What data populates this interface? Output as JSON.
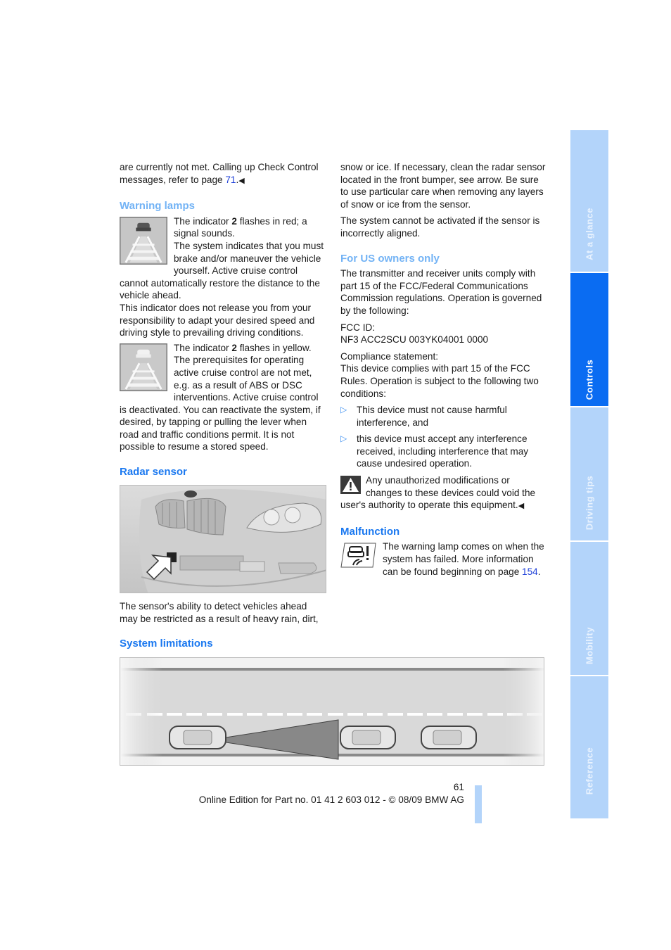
{
  "left_column": {
    "intro": {
      "text_before": "are currently not met. Calling up Check Control messages, refer to page ",
      "link": "71",
      "text_after": ".",
      "end_mark": "◀"
    },
    "warning_lamps": {
      "heading": "Warning lamps",
      "red": {
        "icon": "acc-warning-lamp-red-icon",
        "t1": "The indicator ",
        "bold": "2",
        "t2": " flashes in red; a signal sounds.",
        "body": "The system indicates that you must brake and/or maneuver the vehicle yourself. Active cruise control cannot automatically restore the distance to the vehicle ahead.",
        "note": "This indicator does not release you from your responsibility to adapt your desired speed and driving style to prevailing driving conditions."
      },
      "yellow": {
        "icon": "acc-warning-lamp-yellow-icon",
        "t1": "The indicator ",
        "bold": "2",
        "t2": " flashes in yellow.",
        "body": "The prerequisites for operating active cruise control are not met, e.g. as a result of ABS or DSC interventions. Active cruise control is deactivated. You can reactivate the system, if desired, by tapping or pulling the lever when road and traffic conditions permit. It is not possible to resume a stored speed."
      }
    },
    "radar_sensor": {
      "heading": "Radar sensor",
      "image_alt": "Front bumper with arrow pointing to radar sensor",
      "text": "The sensor's ability to detect vehicles ahead may be restricted as a result of heavy rain, dirt,"
    },
    "system_limitations": {
      "heading": "System limitations",
      "image_alt": "Road diagram with radar beam and vehicles ahead"
    }
  },
  "right_column": {
    "continued": "snow or ice. If necessary, clean the radar sensor located in the front bumper, see arrow. Be sure to use particular care when removing any layers of snow or ice from the sensor.",
    "alignment": "The system cannot be activated if the sensor is incorrectly aligned.",
    "us_owners": {
      "heading": "For US owners only",
      "text": "The transmitter and receiver units comply with part 15 of the FCC/Federal Communications Commission regulations. Operation is governed by the following:",
      "fcc_label": "FCC ID:",
      "fcc_id": "NF3 ACC2SCU 003YK04001 0000",
      "compliance_label": "Compliance statement:",
      "compliance_text": "This device complies with part 15 of the FCC Rules. Operation is subject to the following two conditions:",
      "bullets": [
        "This device must not cause harmful interference, and",
        "this device must accept any interference received, including interference that may cause undesired operation."
      ],
      "bullet_marker": "▷",
      "warning": {
        "icon": "warning-triangle-icon",
        "text": "Any unauthorized modifications or changes to these devices could void the user's authority to operate this equipment.",
        "end_mark": "◀"
      }
    },
    "malfunction": {
      "heading": "Malfunction",
      "icon": "acc-malfunction-lamp-icon",
      "text_before": "The warning lamp comes on when the system has failed. More information can be found beginning on page ",
      "link": "154",
      "text_after": "."
    }
  },
  "side_tabs": [
    {
      "label": "At a glance",
      "active": false
    },
    {
      "label": "Controls",
      "active": true
    },
    {
      "label": "Driving tips",
      "active": false
    },
    {
      "label": "Mobility",
      "active": false
    },
    {
      "label": "Reference",
      "active": false
    }
  ],
  "footer": {
    "page_number": "61",
    "edition": "Online Edition for Part no. 01 41 2 603 012 - © 08/09 BMW AG"
  },
  "colors": {
    "heading_light": "#73b3f5",
    "heading_strong": "#1a78f0",
    "link": "#1d3fd8",
    "tab_active": "#0a6cf2",
    "tab_inactive": "#b3d4fa"
  }
}
